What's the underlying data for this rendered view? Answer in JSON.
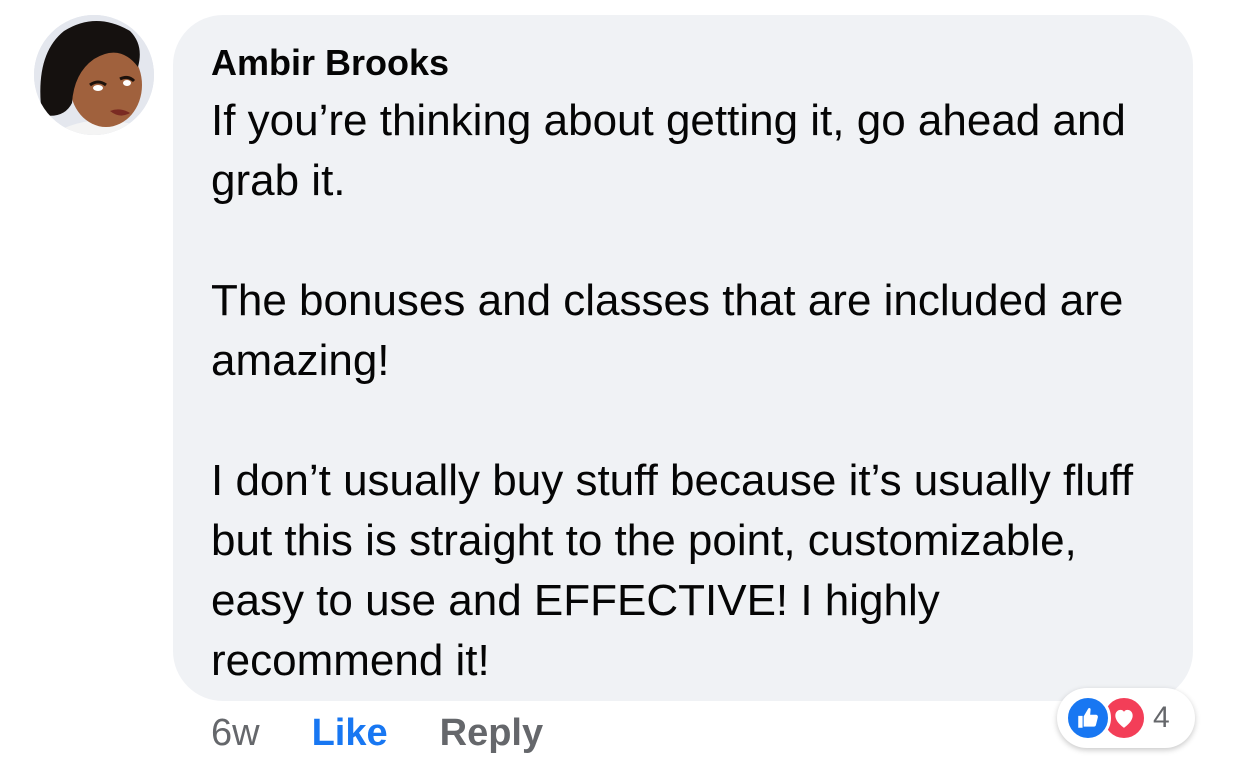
{
  "comment": {
    "author": "Ambir Brooks",
    "paragraphs": [
      "If you’re thinking about getting it, go ahead and grab it.",
      "The bonuses and classes that are included are amazing!",
      "I don’t usually buy stuff because it’s usually fluff but this is straight to the point, customizable, easy to use and EFFECTIVE! I highly recommend it!"
    ]
  },
  "actions": {
    "time": "6w",
    "like_label": "Like",
    "reply_label": "Reply"
  },
  "reactions": {
    "icons": [
      "like-icon",
      "love-icon"
    ],
    "count": "4"
  },
  "colors": {
    "bubble": "#f0f2f5",
    "like_blue": "#1877f2",
    "love_red": "#f33e58",
    "meta_gray": "#65676b"
  }
}
